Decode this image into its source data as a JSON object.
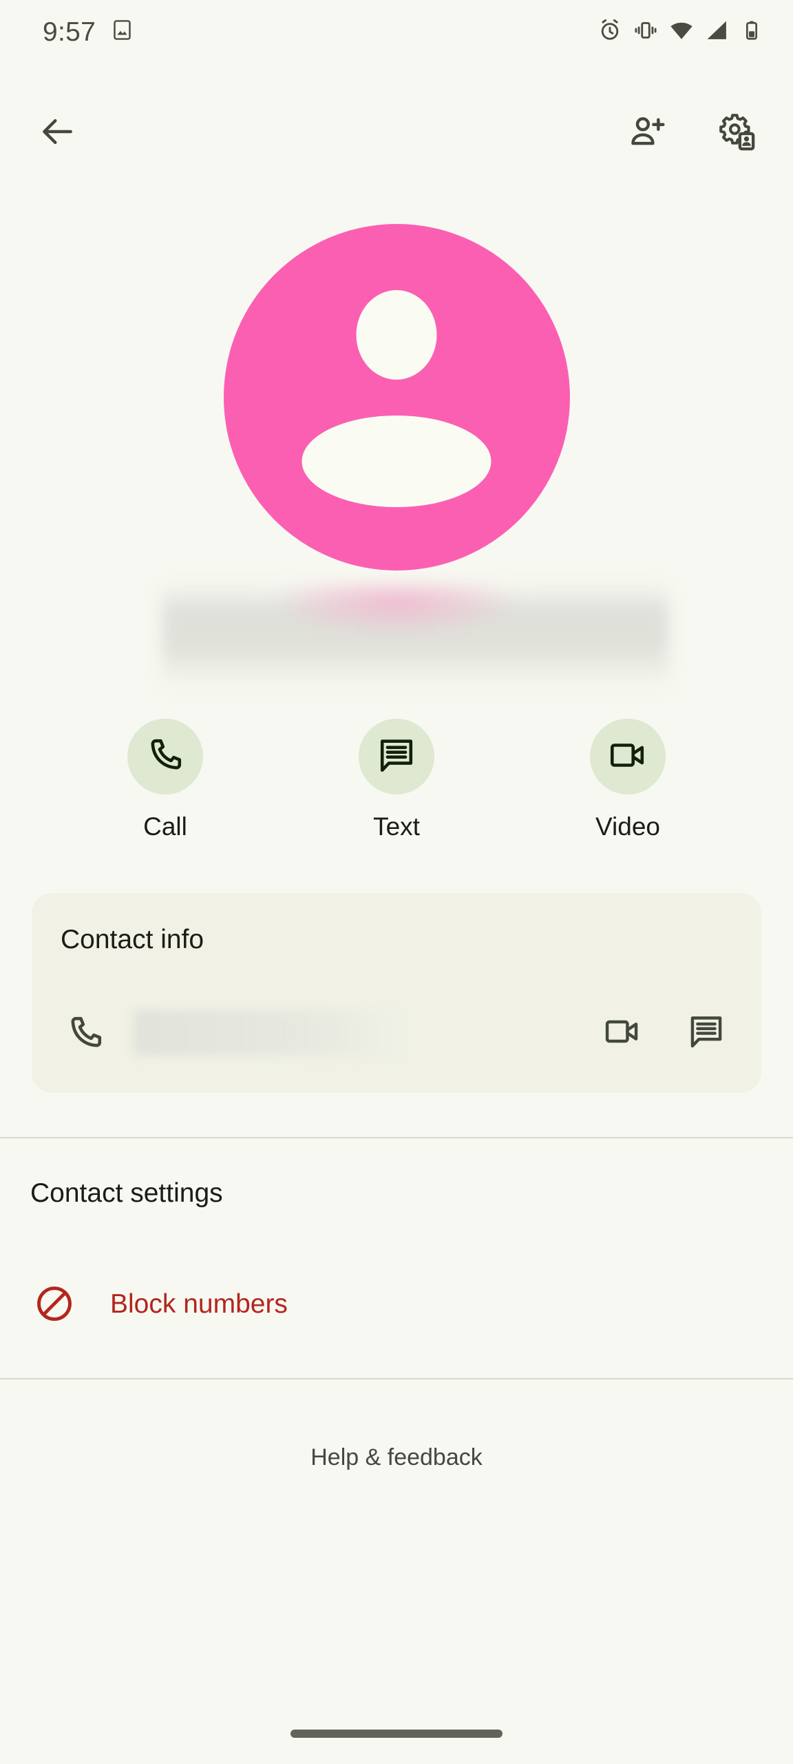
{
  "status_bar": {
    "time": "9:57",
    "left_icons": [
      {
        "name": "photo-notification-icon"
      }
    ],
    "right_icons": [
      {
        "name": "alarm-icon"
      },
      {
        "name": "vibrate-icon"
      },
      {
        "name": "wifi-icon"
      },
      {
        "name": "cellular-signal-icon"
      },
      {
        "name": "battery-icon"
      }
    ]
  },
  "app_bar": {
    "back_icon": "arrow-back-icon",
    "add_contact_icon": "person-add-icon",
    "manage_accounts_icon": "manage-accounts-gear-icon"
  },
  "contact": {
    "avatar_color": "#FB5FB2",
    "avatar_icon": "person-avatar-icon",
    "name": "",
    "name_redacted": true
  },
  "actions": [
    {
      "label": "Call",
      "icon": "phone-icon"
    },
    {
      "label": "Text",
      "icon": "message-icon"
    },
    {
      "label": "Video",
      "icon": "videocam-icon"
    }
  ],
  "contact_info": {
    "title": "Contact info",
    "phone": {
      "icon": "phone-icon",
      "value": "",
      "value_redacted": true,
      "trailing_icons": [
        {
          "name": "videocam-icon"
        },
        {
          "name": "message-icon"
        }
      ]
    }
  },
  "contact_settings": {
    "title": "Contact settings",
    "items": [
      {
        "label": "Block numbers",
        "icon": "block-icon",
        "color": "#B3261E"
      }
    ]
  },
  "footer": {
    "help_label": "Help & feedback"
  },
  "colors": {
    "background": "#F7F8F1",
    "card_background": "#F1F2E5",
    "action_circle": "#DFE8D1",
    "on_surface": "#1A1C16",
    "icon": "#43483C",
    "error": "#B3261E",
    "avatar": "#FB5FB2",
    "divider": "#D6D8CC",
    "gesture_bar": "#62645B"
  }
}
